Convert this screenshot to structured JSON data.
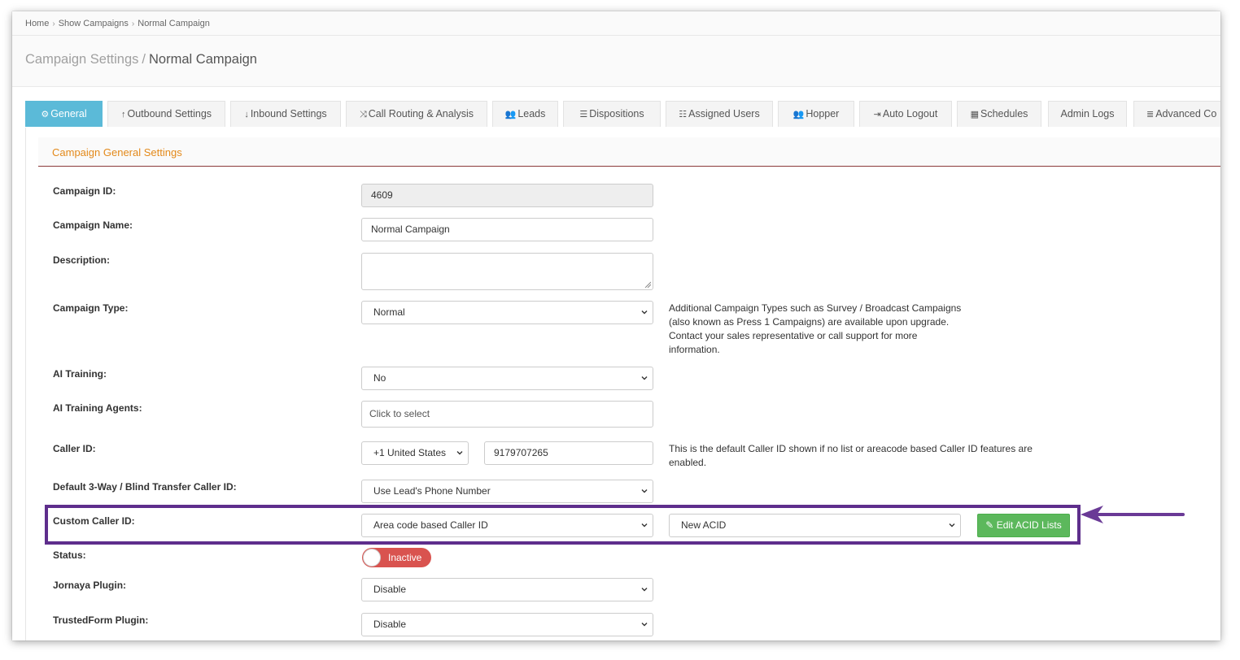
{
  "breadcrumb": [
    "Home",
    "Show Campaigns",
    "Normal Campaign"
  ],
  "header": {
    "section": "Campaign Settings",
    "title": "Normal Campaign"
  },
  "tabs": [
    {
      "label": "General",
      "icon": "cogs-icon",
      "active": true
    },
    {
      "label": "Outbound Settings",
      "icon": "arrow-up-icon"
    },
    {
      "label": "Inbound Settings",
      "icon": "arrow-down-icon"
    },
    {
      "label": "Call Routing & Analysis",
      "icon": "random-icon"
    },
    {
      "label": "Leads",
      "icon": "users-icon"
    },
    {
      "label": "Dispositions",
      "icon": "list-icon"
    },
    {
      "label": "Assigned Users",
      "icon": "list-ol-icon"
    },
    {
      "label": "Hopper",
      "icon": "users-icon"
    },
    {
      "label": "Auto Logout",
      "icon": "sign-out-icon"
    },
    {
      "label": "Schedules",
      "icon": "calendar-icon"
    },
    {
      "label": "Admin Logs",
      "icon": ""
    },
    {
      "label": "Advanced Co",
      "icon": "server-icon"
    }
  ],
  "panel_title": "Campaign General Settings",
  "fields": {
    "campaign_id": {
      "label": "Campaign ID:",
      "value": "4609"
    },
    "campaign_name": {
      "label": "Campaign Name:",
      "value": "Normal Campaign"
    },
    "description": {
      "label": "Description:",
      "value": ""
    },
    "campaign_type": {
      "label": "Campaign Type:",
      "value": "Normal",
      "help": "Additional Campaign Types such as Survey / Broadcast Campaigns (also known as Press 1 Campaigns) are available upon upgrade. Contact your sales representative or call support for more information."
    },
    "ai_training": {
      "label": "AI Training:",
      "value": "No"
    },
    "ai_training_agents": {
      "label": "AI Training Agents:",
      "placeholder": "Click to select"
    },
    "caller_id": {
      "label": "Caller ID:",
      "country": "+1 United States",
      "number": "9179707265",
      "help": "This is the default Caller ID shown if no list or areacode based Caller ID features are enabled."
    },
    "transfer_caller_id": {
      "label": "Default 3-Way / Blind Transfer Caller ID:",
      "value": "Use Lead's Phone Number"
    },
    "custom_caller_id": {
      "label": "Custom Caller ID:",
      "value": "Area code based Caller ID",
      "acid_list": "New ACID",
      "edit_button": "Edit ACID Lists"
    },
    "status": {
      "label": "Status:",
      "value": "Inactive"
    },
    "jornaya": {
      "label": "Jornaya Plugin:",
      "value": "Disable"
    },
    "trustedform": {
      "label": "TrustedForm Plugin:",
      "value": "Disable"
    }
  },
  "colors": {
    "active_tab": "#5bbad8",
    "panel_title": "#e3891a",
    "highlight": "#5e2e8c",
    "button_green": "#5cb85c",
    "toggle_red": "#d9534f"
  }
}
